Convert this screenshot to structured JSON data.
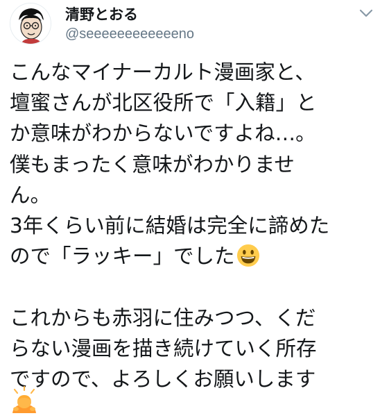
{
  "tweet": {
    "display_name": "清野とおる",
    "handle": "@seeeeeeeeeeeeno",
    "avatar_icon": "manga-face-avatar",
    "menu_icon": "chevron-down-icon",
    "lines": [
      "こんなマイナーカルト漫画家と、",
      "壇蜜さんが北区役所で「入籍」と",
      "か意味がわからないですよね…。",
      "僕もまったく意味がわかりませ",
      "ん。",
      "3年くらい前に結婚は完全に諦めた",
      "ので「ラッキー」でした",
      "",
      "これからも赤羽に住みつつ、くだ",
      "らない漫画を描き続けていく所存",
      "ですので、よろしくお願いします"
    ],
    "inline_emoji": "grinning-face-emoji",
    "trailing_emoji": "person-bowing-emoji"
  },
  "colors": {
    "text": "#14171a",
    "secondary": "#657786",
    "emoji_yellow": "#ffcc4d",
    "emoji_skin": "#ffb84a"
  }
}
